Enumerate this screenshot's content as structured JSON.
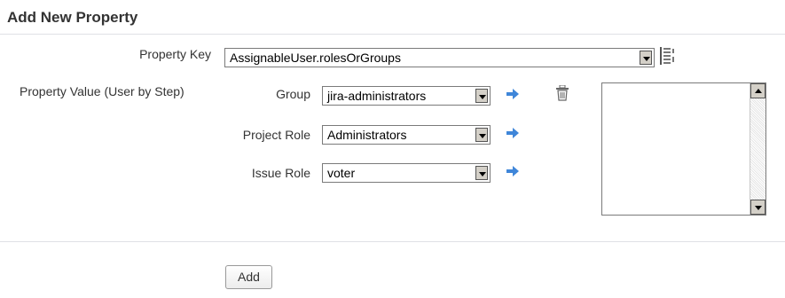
{
  "header": {
    "title": "Add New Property"
  },
  "form": {
    "property_key": {
      "label": "Property Key",
      "value": "AssignableUser.rolesOrGroups"
    },
    "property_value": {
      "label": "Property Value (User by Step)",
      "group": {
        "label": "Group",
        "value": "jira-administrators"
      },
      "project_role": {
        "label": "Project Role",
        "value": "Administrators"
      },
      "issue_role": {
        "label": "Issue Role",
        "value": "voter"
      },
      "selected_values": []
    },
    "add_label": "Add"
  },
  "icons": {
    "arrow": "arrow-right-icon",
    "trash": "trash-icon",
    "list": "list-icon"
  },
  "colors": {
    "arrow": "#3f86d9",
    "rule": "#dfe1e5"
  }
}
